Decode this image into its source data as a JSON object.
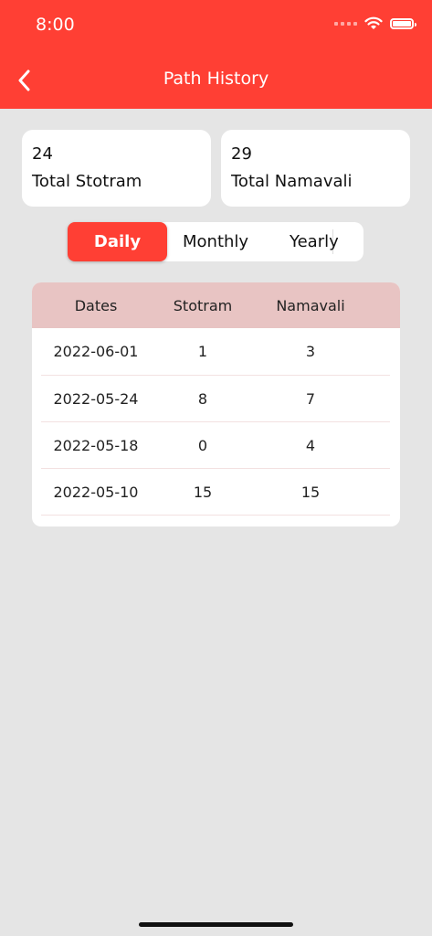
{
  "status_bar": {
    "time": "8:00"
  },
  "header": {
    "title": "Path History"
  },
  "stats": [
    {
      "value": "24",
      "label": "Total Stotram"
    },
    {
      "value": "29",
      "label": "Total Namavali"
    }
  ],
  "tabs": [
    {
      "label": "Daily",
      "active": true
    },
    {
      "label": "Monthly",
      "active": false
    },
    {
      "label": "Yearly",
      "active": false
    }
  ],
  "table": {
    "headers": [
      "Dates",
      "Stotram",
      "Namavali"
    ],
    "rows": [
      [
        "2022-06-01",
        "1",
        "3"
      ],
      [
        "2022-05-24",
        "8",
        "7"
      ],
      [
        "2022-05-18",
        "0",
        "4"
      ],
      [
        "2022-05-10",
        "15",
        "15"
      ]
    ]
  },
  "colors": {
    "accent": "#ff3f34",
    "table_header": "#e8c4c3",
    "background": "#e5e5e5"
  }
}
